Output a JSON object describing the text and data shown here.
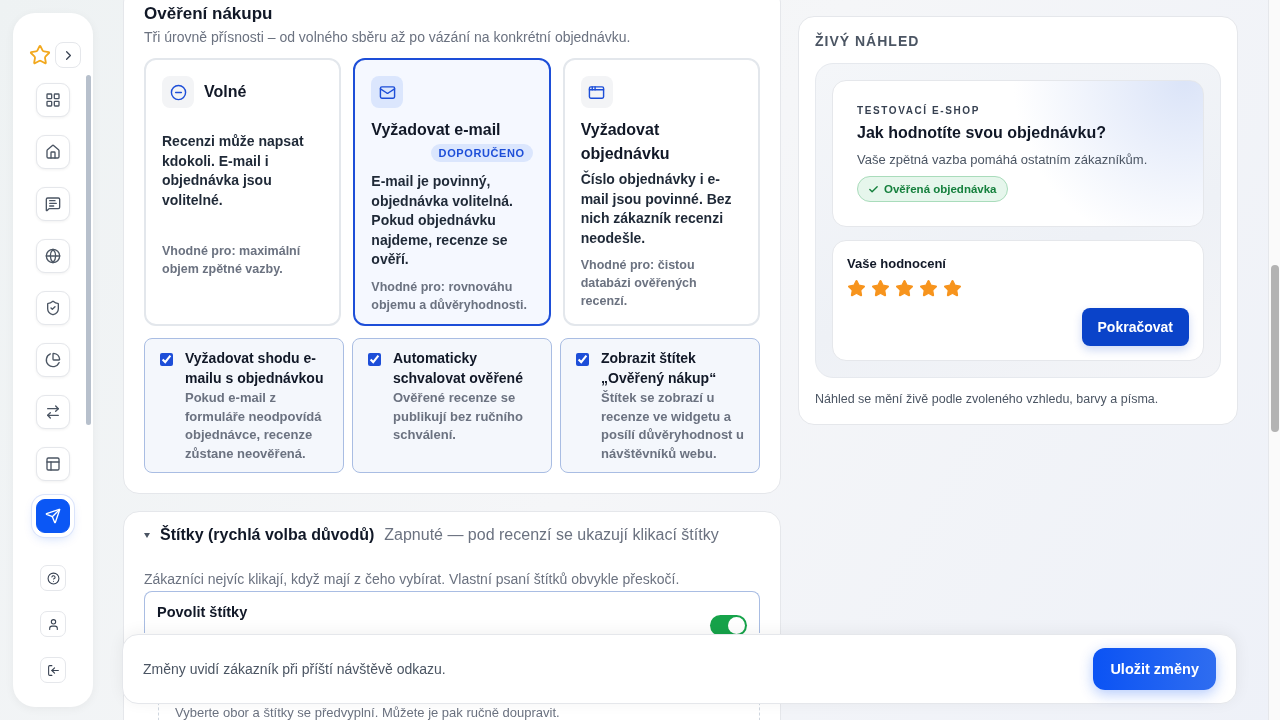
{
  "sidebar": {
    "items": [
      {
        "selected": false
      },
      {
        "selected": false
      },
      {
        "selected": false
      },
      {
        "selected": false
      },
      {
        "selected": false
      },
      {
        "selected": false
      },
      {
        "selected": false
      },
      {
        "selected": false
      },
      {
        "selected": true
      }
    ]
  },
  "verification": {
    "title": "Ověření nákupu",
    "subtitle": "Tři úrovně přísnosti – od volného sběru až po vázání na konkrétní objednávku.",
    "levels": [
      {
        "kind": "open",
        "title": "Volné",
        "description": "Recenzi může napsat kdokoli. E-mail i objednávka jsou volitelné.",
        "hint": "Vhodné pro: maximální objem zpětné vazby.",
        "selected": false
      },
      {
        "kind": "email",
        "title": "Vyžadovat e-mail",
        "badge": "DOPORUČENO",
        "description": "E-mail je povinný, objednávka volitelná. Pokud objednávku najdeme, recenze se ověří.",
        "hint": "Vhodné pro: rovnováhu objemu a důvěryhodnosti.",
        "selected": true
      },
      {
        "kind": "order",
        "title": "Vyžadovat objednávku",
        "description": "Číslo objednávky i e-mail jsou povinné. Bez nich zákazník recenzi neodešle.",
        "hint": "Vhodné pro: čistou databázi ověřených recenzí.",
        "selected": false
      }
    ],
    "options": [
      {
        "title": "Vyžadovat shodu e-mailu s objednávkou",
        "description": "Pokud e-mail z formuláře neodpovídá objednávce, recenze zůstane neověřená.",
        "checked": true
      },
      {
        "title": "Automaticky schvalovat ověřené",
        "description": "Ověřené recenze se publikují bez ručního schválení.",
        "checked": true
      },
      {
        "title": "Zobrazit štítek „Ověřený nákup“",
        "description": "Štítek se zobrazí u recenze ve widgetu a posílí důvěryhodnost u návštěvníků webu.",
        "checked": true
      }
    ]
  },
  "tags": {
    "expanded": true,
    "title": "Štítky (rychlá volba důvodů)",
    "status": "Zapnuté — pod recenzí se ukazují klikací štítky",
    "description": "Zákazníci nejvíc klikají, když mají z čeho vybírat. Vlastní psaní štítků obvykle přeskočí.",
    "toggle": {
      "label": "Povolit štítky",
      "on": true
    },
    "hint": "Vyberte obor a štítky se předvyplní. Můžete je pak ručně doupravit."
  },
  "preview": {
    "title": "ŽIVÝ NÁHLED",
    "shop": "TESTOVACÍ E-SHOP",
    "question": "Jak hodnotíte svou objednávku?",
    "subtitle": "Vaše zpětná vazba pomáhá ostatním zákazníkům.",
    "badge": "Ověřená objednávka",
    "rating_label": "Vaše hodnocení",
    "stars": 5,
    "button": "Pokračovat",
    "note": "Náhled se mění živě podle zvoleného vzhledu, barvy a písma."
  },
  "footer": {
    "message": "Změny uvidí zákazník při příští návštěvě odkazu.",
    "button": "Uložit změny"
  }
}
